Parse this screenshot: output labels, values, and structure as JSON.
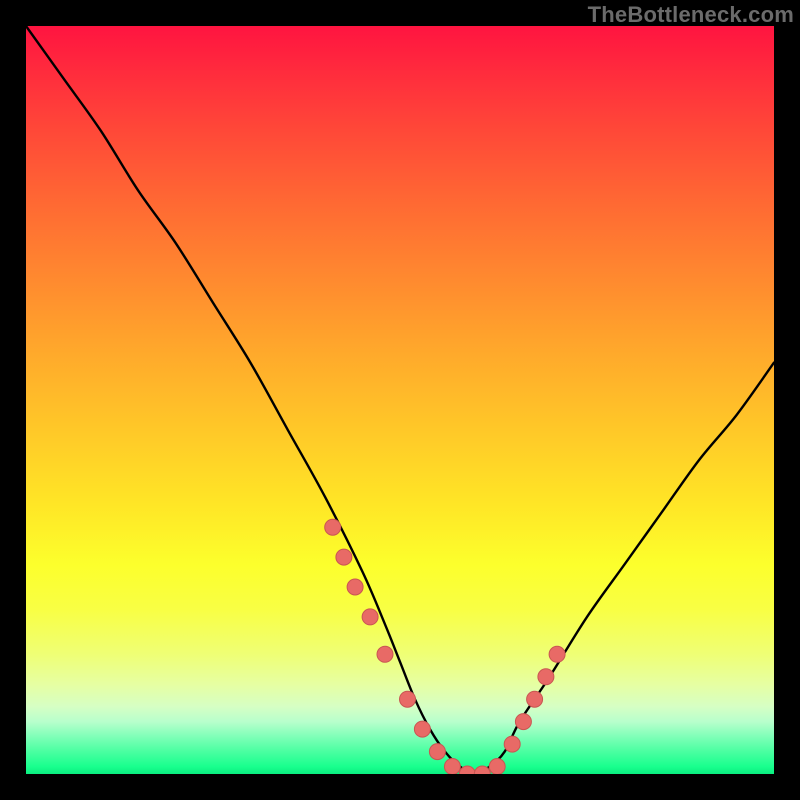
{
  "watermark": {
    "text": "TheBottleneck.com"
  },
  "colors": {
    "frame": "#000000",
    "curve": "#000000",
    "dot_fill": "#e86a66",
    "dot_stroke": "#c95652"
  },
  "chart_data": {
    "type": "line",
    "title": "",
    "xlabel": "",
    "ylabel": "",
    "xlim": [
      0,
      100
    ],
    "ylim": [
      0,
      100
    ],
    "grid": false,
    "series": [
      {
        "name": "bottleneck-curve",
        "x": [
          0,
          5,
          10,
          15,
          20,
          25,
          30,
          35,
          40,
          45,
          48,
          50,
          52,
          54,
          56,
          58,
          60,
          62,
          64,
          66,
          70,
          75,
          80,
          85,
          90,
          95,
          100
        ],
        "values": [
          100,
          93,
          86,
          78,
          71,
          63,
          55,
          46,
          37,
          27,
          20,
          15,
          10,
          6,
          3,
          1,
          0,
          1,
          3,
          7,
          13,
          21,
          28,
          35,
          42,
          48,
          55
        ]
      }
    ],
    "dots": {
      "name": "highlight-points",
      "x": [
        41,
        42.5,
        44,
        46,
        48,
        51,
        53,
        55,
        57,
        59,
        61,
        63,
        65,
        66.5,
        68,
        69.5,
        71
      ],
      "values": [
        33,
        29,
        25,
        21,
        16,
        10,
        6,
        3,
        1,
        0,
        0,
        1,
        4,
        7,
        10,
        13,
        16
      ]
    }
  }
}
